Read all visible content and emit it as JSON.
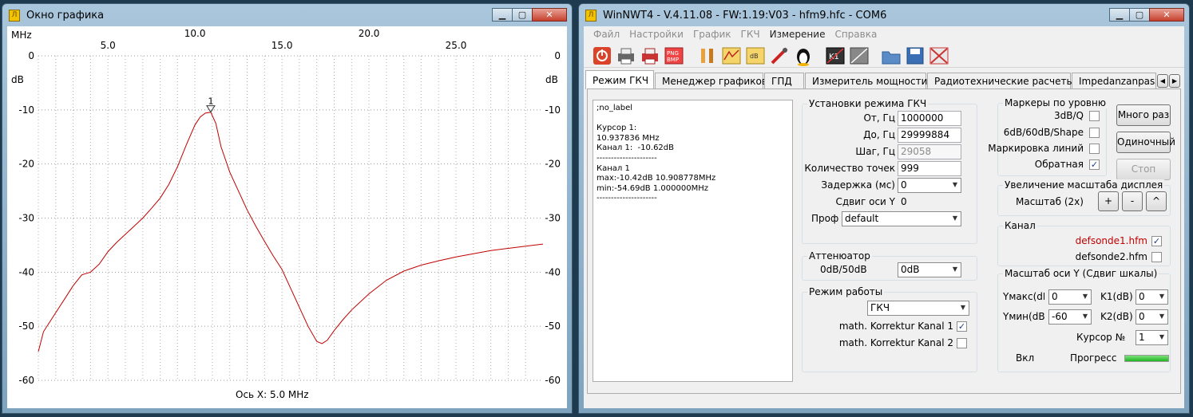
{
  "graph_window": {
    "title": "Окно графика",
    "x_unit": "MHz",
    "y_unit_left": "dB",
    "y_unit_right": "dB",
    "x_axis_label": "Ось X: 5.0 MHz",
    "marker_label": "1"
  },
  "chart_data": {
    "type": "line",
    "xlim": [
      1.0,
      29.999884
    ],
    "ylim": [
      -60,
      0
    ],
    "x_ticks": [
      5.0,
      10.0,
      15.0,
      20.0,
      25.0
    ],
    "x_tick_labels": [
      "5.0",
      "10.0",
      "15.0",
      "20.0",
      "25.0"
    ],
    "y_ticks": [
      0,
      -10,
      -20,
      -30,
      -40,
      -50,
      -60
    ],
    "y_tick_labels": [
      "0",
      "-10",
      "-20",
      "-30",
      "-40",
      "-50",
      "-60"
    ],
    "grid": true,
    "line_color": "#c00000",
    "series": [
      {
        "x": [
          1.0,
          1.3,
          1.8,
          2.5,
          3.0,
          3.5,
          4.0,
          4.5,
          5.0,
          5.5,
          6.0,
          6.5,
          7.0,
          7.5,
          8.0,
          8.5,
          9.0,
          9.5,
          10.0,
          10.3,
          10.6,
          10.908778,
          11.2,
          11.5,
          12.0,
          12.5,
          13.0,
          13.5,
          14.0,
          14.5,
          15.0,
          15.5,
          16.0,
          16.5,
          17.0,
          17.3,
          17.6,
          18.0,
          18.5,
          19.0,
          20.0,
          21.0,
          22.0,
          23.0,
          24.0,
          25.0,
          26.0,
          27.0,
          28.0,
          29.0,
          29.999884
        ],
        "y": [
          -54.69,
          -51.0,
          -48.5,
          -45.0,
          -42.5,
          -40.5,
          -40.0,
          -38.5,
          -36.2,
          -34.5,
          -33.0,
          -31.5,
          -30.0,
          -28.2,
          -26.3,
          -23.8,
          -20.5,
          -16.5,
          -12.8,
          -11.3,
          -10.6,
          -10.42,
          -12.5,
          -16.8,
          -21.5,
          -25.0,
          -28.5,
          -31.5,
          -34.3,
          -37.0,
          -39.5,
          -43.0,
          -46.5,
          -50.0,
          -52.8,
          -53.2,
          -52.6,
          -50.8,
          -48.8,
          -47.0,
          -44.0,
          -41.5,
          -39.8,
          -38.7,
          -37.9,
          -37.2,
          -36.6,
          -36.0,
          -35.6,
          -35.2,
          -34.8
        ]
      }
    ],
    "marker": {
      "x": 10.908778,
      "y": -10.42,
      "label": "1"
    }
  },
  "main_window": {
    "title": "WinNWT4 - V.4.11.08 - FW:1.19:V03 - hfm9.hfc - COM6",
    "menu": [
      "Файл",
      "Настройки",
      "График",
      "ГКЧ",
      "Измерение",
      "Справка"
    ],
    "tabs": [
      "Режим ГКЧ",
      "Менеджер графиков",
      "ГПД",
      "Измеритель мощности",
      "Радиотехнические расчеты",
      "Impedanzanpass"
    ],
    "info_text": ";no_label\n\nКурсор 1:\n10.937836 MHz\nКанал 1:  -10.62dB\n---------------------\nКанал 1\nmax:-10.42dB 10.908778MHz\nmin:-54.69dB 1.000000MHz\n---------------------",
    "sweep": {
      "title": "Установки режима ГКЧ",
      "from_label": "От, Гц",
      "from_value": "1000000",
      "to_label": "До, Гц",
      "to_value": "29999884",
      "step_label": "Шаг, Гц",
      "step_value": "29058",
      "points_label": "Количество точек",
      "points_value": "999",
      "delay_label": "Задержка (мс)",
      "delay_value": "0",
      "yshift_label": "Сдвиг оси Y",
      "yshift_value": "0",
      "profile_label": "Проф",
      "profile_value": "default"
    },
    "attenuator": {
      "title": "Аттенюатор",
      "label": "0dB/50dB",
      "value": "0dB"
    },
    "mode": {
      "title": "Режим работы",
      "value": "ГКЧ",
      "korr1_label": "math. Korrektur Kanal 1",
      "korr1_checked": true,
      "korr2_label": "math. Korrektur Kanal 2",
      "korr2_checked": false
    },
    "markers": {
      "title": "Маркеры по уровню",
      "m1_label": "3dB/Q",
      "m1_checked": false,
      "m2_label": "6dB/60dB/Shape",
      "m2_checked": false,
      "m3_label": "Маркировка линий",
      "m3_checked": false,
      "m4_label": "Обратная",
      "m4_checked": true
    },
    "buttons": {
      "multi": "Много раз",
      "single": "Одиночный",
      "stop": "Стоп"
    },
    "zoom": {
      "title": "Увеличение масштаба дисплея",
      "label": "Масштаб (2x)",
      "plus": "+",
      "minus": "-",
      "up": "^"
    },
    "channel": {
      "title": "Канал",
      "ch1": "defsonde1.hfm",
      "ch1_checked": true,
      "ch1_color": "#c00000",
      "ch2": "defsonde2.hfm",
      "ch2_checked": false
    },
    "yscale": {
      "title": "Масштаб оси Y (Сдвиг шкалы)",
      "ymax_label": "Yмакс(dB",
      "ymax_value": "0",
      "ymin_label": "Yмин(dB",
      "ymin_value": "-60",
      "k1_label": "K1(dB)",
      "k1_value": "0",
      "k2_label": "K2(dB)",
      "k2_value": "0",
      "cursor_label": "Курсор №",
      "cursor_value": "1",
      "on_label": "Вкл",
      "progress_label": "Прогресс",
      "progress_fraction": 1.0
    }
  }
}
